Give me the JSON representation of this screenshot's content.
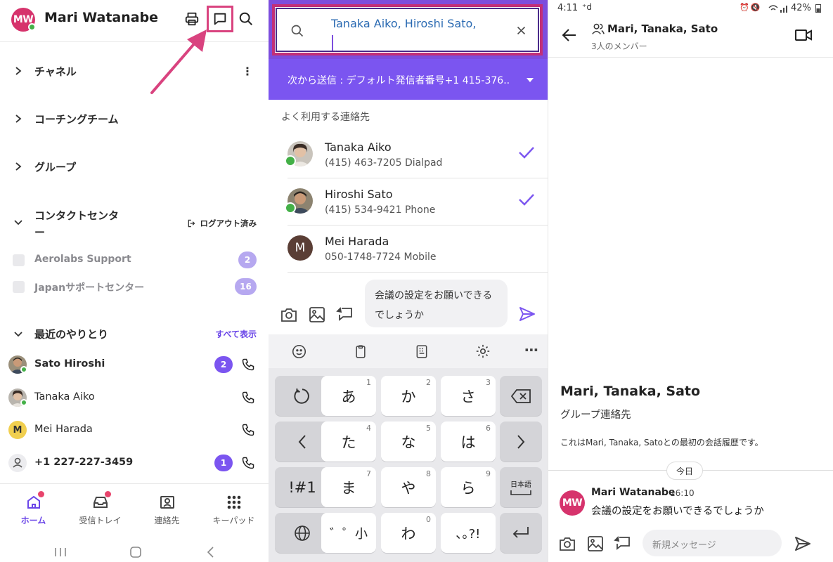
{
  "left": {
    "user_initials": "MW",
    "user_name": "Mari Watanabe",
    "sections": [
      {
        "label": "チャネル"
      },
      {
        "label": "コーチングチーム"
      },
      {
        "label": "グループ"
      }
    ],
    "contact_center": {
      "label_line1": "コンタクトセンタ",
      "label_line2": "ー",
      "logout_label": "ログアウト済み",
      "queues": [
        {
          "label": "Aerolabs Support",
          "count": "2"
        },
        {
          "label": "Japanサポートセンター",
          "count": "16"
        }
      ]
    },
    "recent": {
      "label": "最近のやりとり",
      "see_all": "すべて表示",
      "items": [
        {
          "name": "Sato Hiroshi",
          "badge": "2",
          "bold": true
        },
        {
          "name": "Tanaka Aiko",
          "badge": "",
          "bold": false
        },
        {
          "name": "Mei Harada",
          "initial": "M",
          "badge": "",
          "bold": false
        },
        {
          "name": "+1 227-227-3459",
          "badge": "1",
          "bold": true
        }
      ]
    },
    "nav": [
      {
        "label": "ホーム",
        "icon": "home-icon"
      },
      {
        "label": "受信トレイ",
        "icon": "inbox-icon"
      },
      {
        "label": "連絡先",
        "icon": "contacts-icon"
      },
      {
        "label": "キーパッド",
        "icon": "keypad-icon"
      }
    ]
  },
  "middle": {
    "search_value": "Tanaka Aiko, Hiroshi Sato,",
    "send_from": "次から送信 : デフォルト発信者番号+1 415-376..",
    "section_label": "よく利用する連絡先",
    "contacts": [
      {
        "name": "Tanaka Aiko",
        "sub": "(415) 463-7205 Dialpad",
        "selected": true
      },
      {
        "name": "Hiroshi Sato",
        "sub": "(415) 534-9421 Phone",
        "selected": true
      },
      {
        "name": "Mei Harada",
        "initial": "M",
        "sub": "050-1748-7724 Mobile",
        "selected": false
      }
    ],
    "compose_line1": "会議の設定をお願いできる",
    "compose_line2": "でしょうか",
    "keyboard": {
      "keys": [
        {
          "label": "あ",
          "num": "1"
        },
        {
          "label": "か",
          "num": "2"
        },
        {
          "label": "さ",
          "num": "3"
        },
        {
          "label": "た",
          "num": "4"
        },
        {
          "label": "な",
          "num": "5"
        },
        {
          "label": "は",
          "num": "6"
        },
        {
          "label": "ま",
          "num": "7"
        },
        {
          "label": "や",
          "num": "8"
        },
        {
          "label": "ら",
          "num": "9"
        },
        {
          "label": "゛゜小",
          "num": ""
        },
        {
          "label": "わ",
          "num": "0"
        },
        {
          "label": "､｡?!",
          "num": ""
        }
      ],
      "mode_key": "!#1",
      "lang_key": "日本語"
    }
  },
  "right": {
    "status_time": "4:11",
    "status_battery": "42%",
    "title": "Mari, Tanaka, Sato",
    "subtitle": "3人のメンバー",
    "intro_title": "Mari, Tanaka, Sato",
    "intro_sub": "グループ連絡先",
    "intro_desc": "これはMari, Tanaka, Satoとの最初の会話履歴です。",
    "today": "今日",
    "message": {
      "initials": "MW",
      "sender": "Mari Watanabe",
      "time": "16:10",
      "text": "会議の設定をお願いできるでしょうか"
    },
    "input_placeholder": "新規メッセージ"
  }
}
